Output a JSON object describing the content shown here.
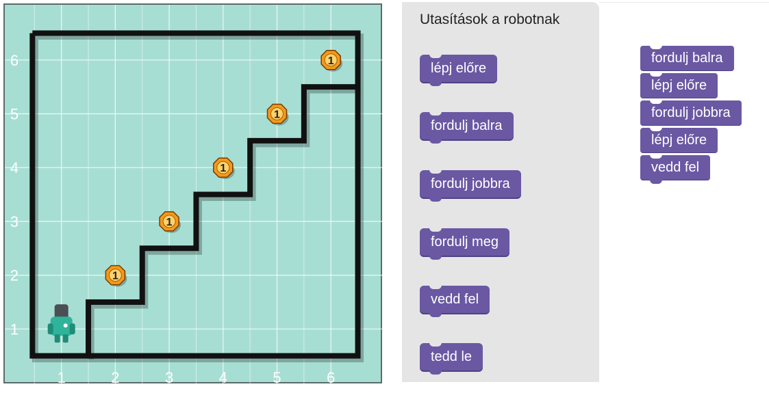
{
  "board": {
    "x_labels": [
      "1",
      "2",
      "3",
      "4",
      "5",
      "6"
    ],
    "y_labels": [
      "1",
      "2",
      "3",
      "4",
      "5",
      "6"
    ],
    "coin_label": "1",
    "coins": [
      {
        "col": 2,
        "row": 2
      },
      {
        "col": 3,
        "row": 3
      },
      {
        "col": 4,
        "row": 4
      },
      {
        "col": 5,
        "row": 5
      },
      {
        "col": 6,
        "row": 6
      }
    ],
    "robot": {
      "col": 1,
      "row": 1,
      "facing": "up"
    },
    "colors": {
      "background": "#a7ded3",
      "grid": "#ffffff",
      "wall": "#111111",
      "coin": "#f29a1d",
      "robot": "#2fb39a"
    }
  },
  "palette": {
    "title": "Utasítások a robotnak",
    "blocks": [
      "lépj előre",
      "fordulj balra",
      "fordulj jobbra",
      "fordulj meg",
      "vedd fel",
      "tedd le"
    ]
  },
  "program": {
    "blocks": [
      "fordulj balra",
      "lépj előre",
      "fordulj jobbra",
      "lépj előre",
      "vedd fel"
    ]
  },
  "colors": {
    "block": "#6a58a3",
    "palette_bg": "#e5e5e5"
  }
}
